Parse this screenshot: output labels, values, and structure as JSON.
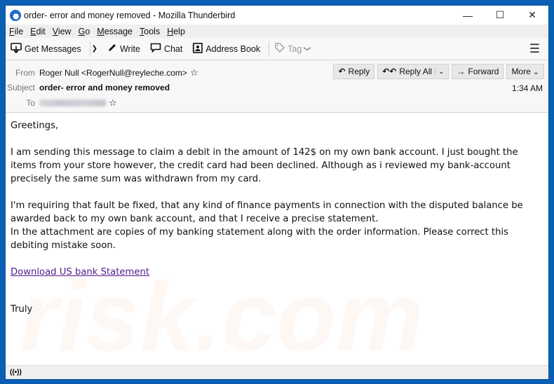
{
  "window": {
    "title": "order- error and money removed - Mozilla Thunderbird",
    "controls": {
      "minimize": "—",
      "maximize": "☐",
      "close": "✕"
    }
  },
  "menubar": {
    "items": [
      {
        "accel": "F",
        "rest": "ile"
      },
      {
        "accel": "E",
        "rest": "dit"
      },
      {
        "accel": "V",
        "rest": "iew"
      },
      {
        "accel": "G",
        "rest": "o"
      },
      {
        "accel": "M",
        "rest": "essage"
      },
      {
        "accel": "T",
        "rest": "ools"
      },
      {
        "accel": "H",
        "rest": "elp"
      }
    ]
  },
  "toolbar": {
    "get_messages": "Get Messages",
    "write": "Write",
    "chat": "Chat",
    "address_book": "Address Book",
    "tag": "Tag",
    "menu_icon": "☰"
  },
  "header": {
    "from_label": "From",
    "from_value": "Roger Null <RogerNull@reyleche.com>",
    "subject_label": "Subject",
    "subject_value": "order- error and money removed",
    "to_label": "To",
    "time": "1:34 AM",
    "buttons": {
      "reply": "Reply",
      "reply_all": "Reply All",
      "forward": "Forward",
      "more": "More"
    }
  },
  "body": {
    "greeting": "Greetings,",
    "paragraph1": "I am sending this message to claim a debit in the amount of 142$ on my own bank account. I just bought the items from your store however, the credit card had been declined. Although as i reviewed my bank-account precisely the same sum was withdrawn from my card.",
    "paragraph2a": "I'm requiring that fault be fixed, that any kind of finance payments in connection with the disputed balance be awarded back to my own bank account, and that I receive a precise statement.",
    "paragraph2b": "In the attachment are copies of my banking statement along with the order information. Please correct this debiting mistake soon.",
    "link": "Download US bank Statement",
    "signoff": "Truly"
  },
  "watermark": "risk.com",
  "statusbar": {
    "icon": "((•))"
  }
}
